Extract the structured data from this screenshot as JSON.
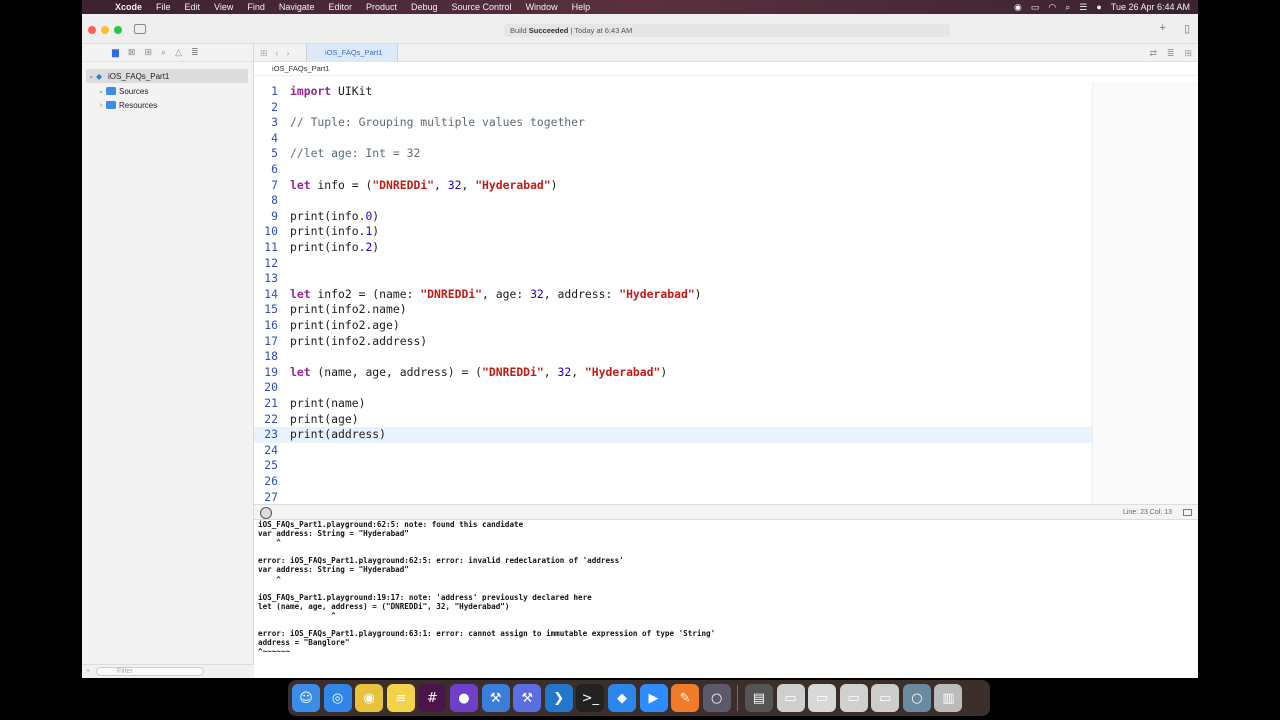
{
  "menubar": {
    "apple": "",
    "items": [
      "Xcode",
      "File",
      "Edit",
      "View",
      "Find",
      "Navigate",
      "Editor",
      "Product",
      "Debug",
      "Source Control",
      "Window",
      "Help"
    ],
    "clock": "Tue 26 Apr  6:44 AM"
  },
  "toolbar": {
    "status_prefix": "Build ",
    "status_bold": "Succeeded",
    "status_suffix": " | Today at 6:43 AM",
    "add_label": "+"
  },
  "tab": {
    "label": "iOS_FAQs_Part1"
  },
  "jumpbar": {
    "path": "iOS_FAQs_Part1"
  },
  "navigator": {
    "project": "iOS_FAQs_Part1",
    "items": [
      {
        "label": "Sources"
      },
      {
        "label": "Resources"
      }
    ],
    "filter_placeholder": "Filter"
  },
  "editor": {
    "cursor": "Line: 23  Col: 13",
    "current_line": 23,
    "lines": [
      "import UIKit",
      "",
      "// Tuple: Grouping multiple values together",
      "",
      "//let age: Int = 32",
      "",
      "let info = (\"DNREDDi\", 32, \"Hyderabad\")",
      "",
      "print(info.0)",
      "print(info.1)",
      "print(info.2)",
      "",
      "",
      "let info2 = (name: \"DNREDDi\", age: 32, address: \"Hyderabad\")",
      "print(info2.name)",
      "print(info2.age)",
      "print(info2.address)",
      "",
      "let (name, age, address) = (\"DNREDDi\", 32, \"Hyderabad\")",
      "",
      "print(name)",
      "print(age)",
      "print(address)",
      "",
      "",
      "",
      ""
    ]
  },
  "console": {
    "lines": [
      "iOS_FAQs_Part1.playground:62:5: note: found this candidate",
      "var address: String = \"Hyderabad\"",
      "    ^",
      "",
      "error: iOS_FAQs_Part1.playground:62:5: error: invalid redeclaration of 'address'",
      "var address: String = \"Hyderabad\"",
      "    ^",
      "",
      "iOS_FAQs_Part1.playground:19:17: note: 'address' previously declared here",
      "let (name, age, address) = (\"DNREDDi\", 32, \"Hyderabad\")",
      "                ^",
      "",
      "error: iOS_FAQs_Part1.playground:63:1: error: cannot assign to immutable expression of type 'String'",
      "address = \"Banglore\"",
      "^~~~~~~"
    ]
  },
  "dock": {
    "apps": [
      {
        "name": "finder-icon",
        "glyph": "☺",
        "color": "#3b8ee8"
      },
      {
        "name": "safari-icon",
        "glyph": "◎",
        "color": "#2f86e6"
      },
      {
        "name": "chrome-icon",
        "glyph": "◉",
        "color": "#e7c23c"
      },
      {
        "name": "notes-icon",
        "glyph": "≡",
        "color": "#f4d34a"
      },
      {
        "name": "slack-icon",
        "glyph": "#",
        "color": "#4a154b"
      },
      {
        "name": "github-icon",
        "glyph": "●",
        "color": "#6e40c9"
      },
      {
        "name": "xcode-icon",
        "glyph": "⚒",
        "color": "#3b7dd8"
      },
      {
        "name": "xcode-beta-icon",
        "glyph": "⚒",
        "color": "#5a6ee0"
      },
      {
        "name": "vscode-icon",
        "glyph": "❯",
        "color": "#2277cc"
      },
      {
        "name": "terminal-icon",
        "glyph": ">_",
        "color": "#222222"
      },
      {
        "name": "maps-icon",
        "glyph": "◆",
        "color": "#2a86e8"
      },
      {
        "name": "zoom-icon",
        "glyph": "▶",
        "color": "#2d8cff"
      },
      {
        "name": "pencil-icon",
        "glyph": "✎",
        "color": "#f07c2a"
      },
      {
        "name": "simulator-icon",
        "glyph": "○",
        "color": "#5a5a6a"
      }
    ],
    "docs": [
      {
        "name": "document-icon",
        "glyph": "▤",
        "color": "#555555"
      },
      {
        "name": "window-preview-icon",
        "glyph": "▭",
        "color": "#cfcfcf"
      },
      {
        "name": "window-preview-icon-2",
        "glyph": "▭",
        "color": "#d8d8d8"
      },
      {
        "name": "window-preview-icon-3",
        "glyph": "▭",
        "color": "#d0d0d0"
      },
      {
        "name": "window-preview-icon-4",
        "glyph": "▭",
        "color": "#cccccc"
      },
      {
        "name": "window-preview-icon-5",
        "glyph": "○",
        "color": "#6a8aa0"
      },
      {
        "name": "trash-icon",
        "glyph": "▥",
        "color": "#bbbbbb"
      }
    ]
  }
}
